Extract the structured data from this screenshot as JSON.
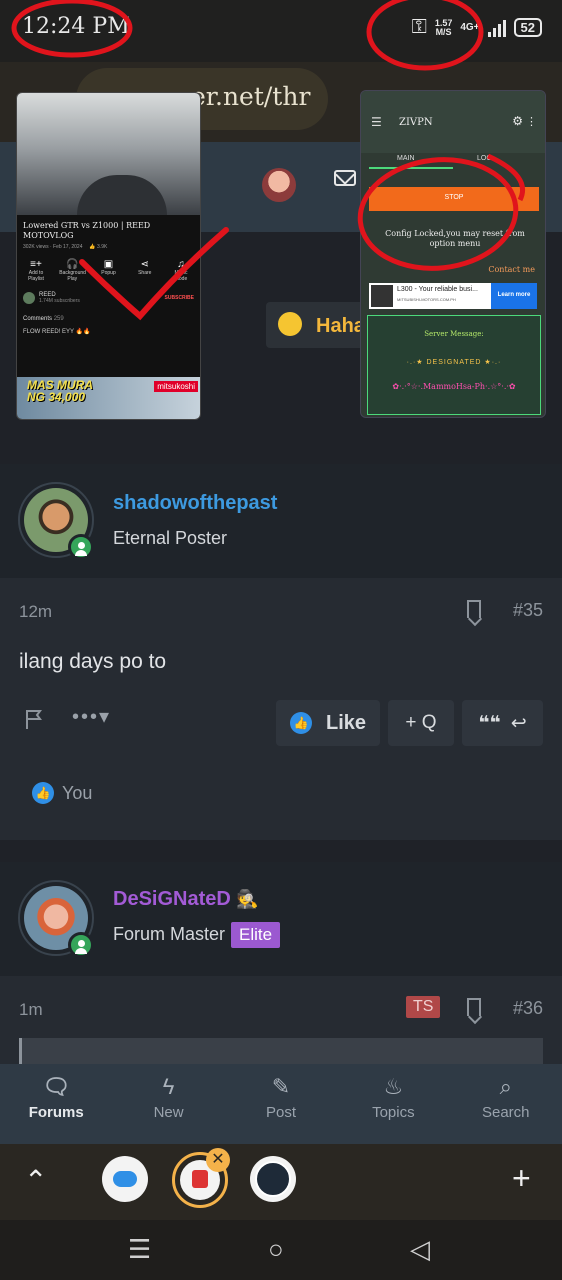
{
  "status_bar": {
    "time": "12:24 PM",
    "speed_value": "1.57",
    "speed_unit": "M/S",
    "network": "4G+",
    "battery": "52",
    "icons": [
      "key-icon",
      "signal-icon",
      "battery-icon"
    ]
  },
  "browser": {
    "url_text": "er.net/thr"
  },
  "header": {
    "reaction_label": "Haha"
  },
  "overlay_youtube": {
    "title": "Lowered GTR vs Z1000 | REED MOTOVLOG",
    "meta": "302K views · Feb 17, 2024",
    "likes": "3.9K",
    "actions": [
      {
        "icon": "add-icon",
        "label": "Add to Playlist"
      },
      {
        "icon": "headphones-icon",
        "label": "Background Play"
      },
      {
        "icon": "popup-icon",
        "label": "Popup"
      },
      {
        "icon": "share-icon",
        "label": "Share"
      },
      {
        "icon": "music-icon",
        "label": "Music mode"
      }
    ],
    "channel": "REED",
    "subscribers": "1.74M subscribers",
    "subscribe": "SUBSCRIBE",
    "comments_label": "Comments",
    "comments_count": "259",
    "comment_text": "FLOW REED! EYY 🔥🔥",
    "ad_text": "MAS MURA NG 34,000",
    "ad_brand": "mitsukoshi"
  },
  "overlay_vpn": {
    "app_name": "ZIVPN",
    "tab1": "MAIN",
    "tab2": "LOG",
    "stop_label": "STOP",
    "message": "Config Locked,you may reset from option menu",
    "contact": "Contact me",
    "ad_title": "L300 - Your reliable busi...",
    "ad_sub": "MITSUBISHI-MOTORS.COM.PH",
    "learn_more": "Learn more",
    "server_label": "Server Message:",
    "server_name": "·.·★ DESIGNATED ★·.·",
    "server_name2": "✿·.·°☆·.MammoHsa-Ph·.☆°·.·✿"
  },
  "posts": [
    {
      "username": "shadowofthepast",
      "user_title": "Eternal Poster",
      "time": "12m",
      "number": "#35",
      "body": "ilang days po to",
      "like_label": "Like",
      "quote_label": "+ Q",
      "reaction_user": "You",
      "username_color": "#3d9ae0"
    },
    {
      "username": "DeSiGNateD",
      "user_title": "Forum Master",
      "badge": "Elite",
      "time": "1m",
      "ts_badge": "TS",
      "number": "#36",
      "username_color": "#a35bd6"
    }
  ],
  "bottom_nav": [
    {
      "icon": "forums-icon",
      "label": "Forums",
      "active": true
    },
    {
      "icon": "new-icon",
      "label": "New"
    },
    {
      "icon": "post-icon",
      "label": "Post"
    },
    {
      "icon": "topics-icon",
      "label": "Topics"
    },
    {
      "icon": "search-icon",
      "label": "Search"
    }
  ],
  "annotation_color": "#e0141c"
}
